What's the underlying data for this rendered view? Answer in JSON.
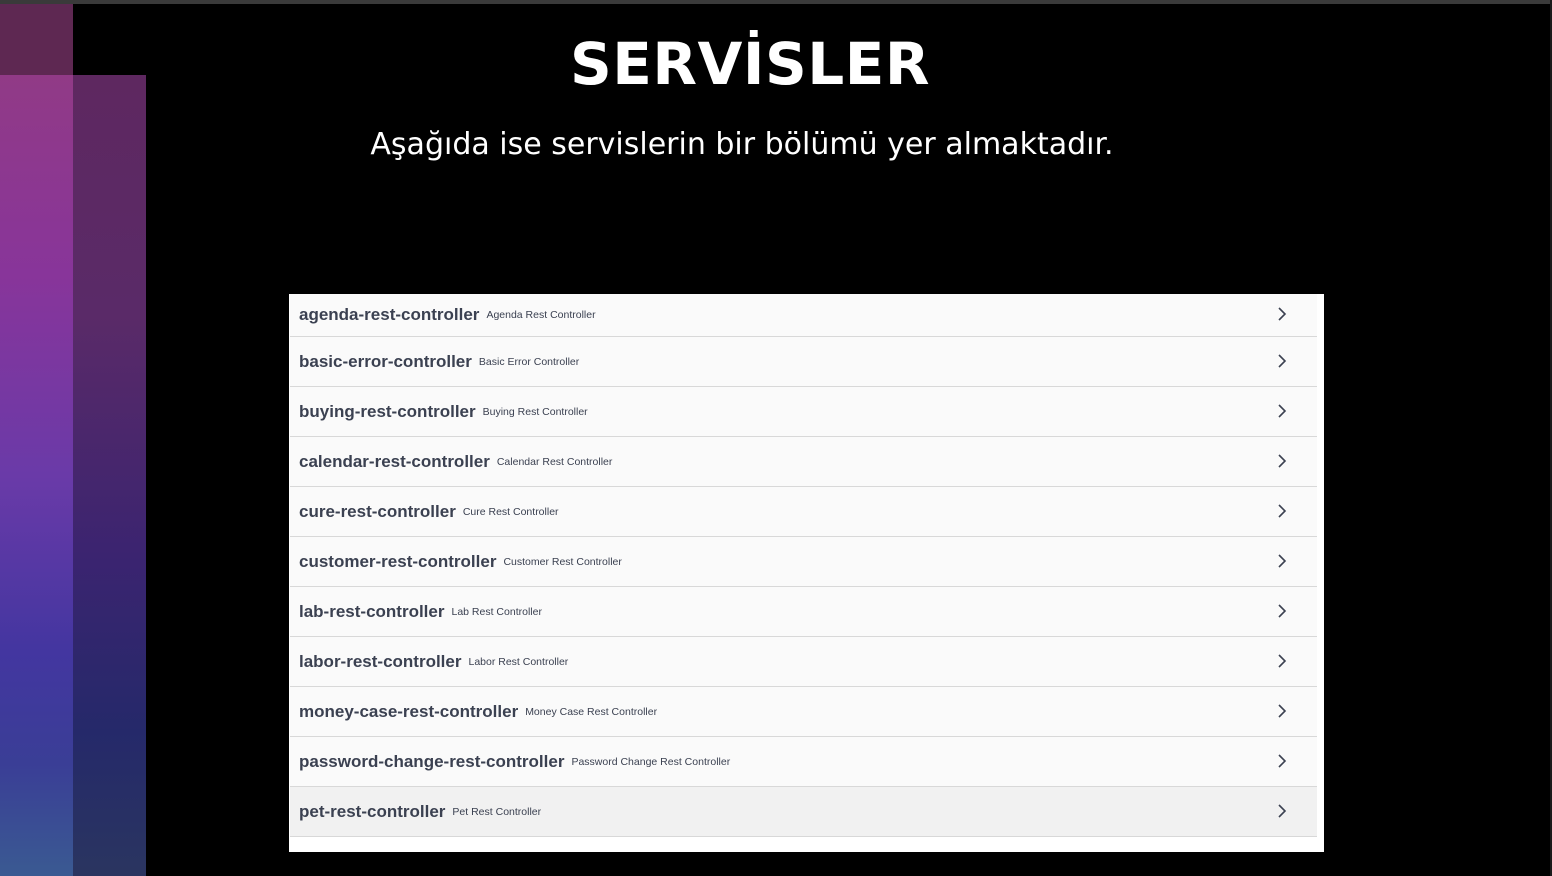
{
  "slide": {
    "title": "SERVİSLER",
    "subtitle": "Aşağıda ise servislerin bir bölümü yer almaktadır."
  },
  "controllers": [
    {
      "name": "agenda-rest-controller",
      "description": "Agenda Rest Controller",
      "icon": "chevron-right-icon"
    },
    {
      "name": "basic-error-controller",
      "description": "Basic Error Controller",
      "icon": "chevron-right-icon"
    },
    {
      "name": "buying-rest-controller",
      "description": "Buying Rest Controller",
      "icon": "chevron-right-icon"
    },
    {
      "name": "calendar-rest-controller",
      "description": "Calendar Rest Controller",
      "icon": "chevron-right-icon"
    },
    {
      "name": "cure-rest-controller",
      "description": "Cure Rest Controller",
      "icon": "chevron-right-icon"
    },
    {
      "name": "customer-rest-controller",
      "description": "Customer Rest Controller",
      "icon": "chevron-right-icon"
    },
    {
      "name": "lab-rest-controller",
      "description": "Lab Rest Controller",
      "icon": "chevron-right-icon"
    },
    {
      "name": "labor-rest-controller",
      "description": "Labor Rest Controller",
      "icon": "chevron-right-icon"
    },
    {
      "name": "money-case-rest-controller",
      "description": "Money Case Rest Controller",
      "icon": "chevron-right-icon"
    },
    {
      "name": "password-change-rest-controller",
      "description": "Password Change Rest Controller",
      "icon": "chevron-right-icon"
    },
    {
      "name": "pet-rest-controller",
      "description": "Pet Rest Controller",
      "icon": "chevron-right-icon"
    }
  ],
  "colors": {
    "background": "#000000",
    "text_light": "#ffffff",
    "panel_row": "#fafafa",
    "controller_text": "#3b4151"
  }
}
